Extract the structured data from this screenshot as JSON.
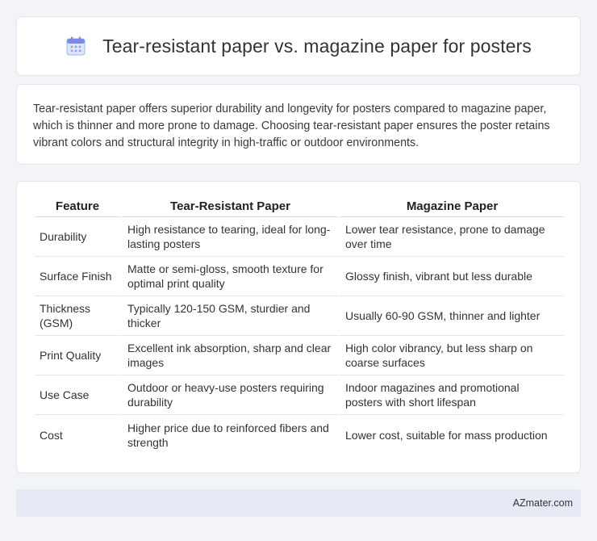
{
  "header": {
    "title": "Tear-resistant paper vs. magazine paper for posters",
    "icon": "calendar-icon"
  },
  "intro": {
    "text": "Tear-resistant paper offers superior durability and longevity for posters compared to magazine paper, which is thinner and more prone to damage. Choosing tear-resistant paper ensures the poster retains vibrant colors and structural integrity in high-traffic or outdoor environments."
  },
  "table": {
    "headers": [
      "Feature",
      "Tear-Resistant Paper",
      "Magazine Paper"
    ],
    "rows": [
      [
        "Durability",
        "High resistance to tearing, ideal for long-lasting posters",
        "Lower tear resistance, prone to damage over time"
      ],
      [
        "Surface Finish",
        "Matte or semi-gloss, smooth texture for optimal print quality",
        "Glossy finish, vibrant but less durable"
      ],
      [
        "Thickness (GSM)",
        "Typically 120-150 GSM, sturdier and thicker",
        "Usually 60-90 GSM, thinner and lighter"
      ],
      [
        "Print Quality",
        "Excellent ink absorption, sharp and clear images",
        "High color vibrancy, but less sharp on coarse surfaces"
      ],
      [
        "Use Case",
        "Outdoor or heavy-use posters requiring durability",
        "Indoor magazines and promotional posters with short lifespan"
      ],
      [
        "Cost",
        "Higher price due to reinforced fibers and strength",
        "Lower cost, suitable for mass production"
      ]
    ]
  },
  "footer": {
    "brand": "AZmater.com"
  },
  "colors": {
    "background": "#f3f4f8",
    "card": "#ffffff",
    "footer": "#e6eaf4"
  }
}
